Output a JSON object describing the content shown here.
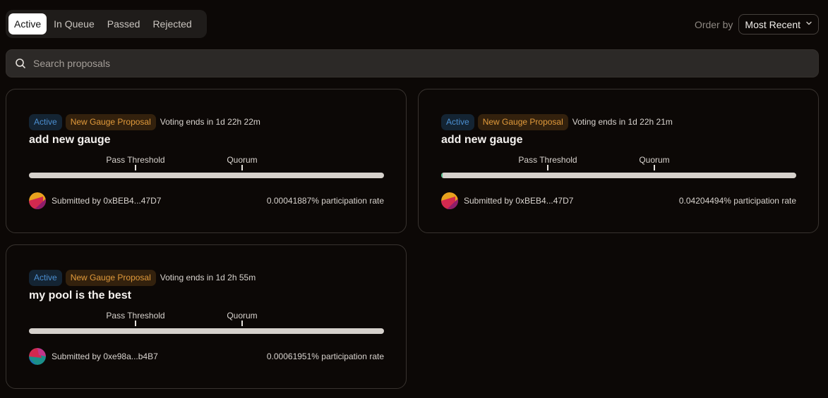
{
  "tabs": [
    {
      "label": "Active",
      "active": true
    },
    {
      "label": "In Queue",
      "active": false
    },
    {
      "label": "Passed",
      "active": false
    },
    {
      "label": "Rejected",
      "active": false
    }
  ],
  "order": {
    "label": "Order by",
    "value": "Most Recent"
  },
  "search": {
    "placeholder": "Search proposals",
    "icon": "search-icon"
  },
  "labels": {
    "pass_threshold": "Pass Threshold",
    "quorum": "Quorum"
  },
  "colors": {
    "status_active": "#4c8fd1",
    "type_badge": "#e19a3b",
    "progress_fill": "#4fbf8a"
  },
  "proposals": [
    {
      "status": "Active",
      "type": "New Gauge Proposal",
      "voting_ends": "Voting ends in 1d 22h 22m",
      "title": "add new gauge",
      "submitted_by": "Submitted by 0xBEB4...47D7",
      "participation": "0.00041887% participation rate",
      "progress_fraction": 0.0,
      "pass_threshold_fraction": 0.3,
      "quorum_fraction": 0.6
    },
    {
      "status": "Active",
      "type": "New Gauge Proposal",
      "voting_ends": "Voting ends in 1d 22h 21m",
      "title": "add new gauge",
      "submitted_by": "Submitted by 0xBEB4...47D7",
      "participation": "0.04204494% participation rate",
      "progress_fraction": 0.004,
      "pass_threshold_fraction": 0.3,
      "quorum_fraction": 0.6
    },
    {
      "status": "Active",
      "type": "New Gauge Proposal",
      "voting_ends": "Voting ends in 1d 2h 55m",
      "title": "my pool is the best",
      "submitted_by": "Submitted by 0xe98a...b4B7",
      "participation": "0.00061951% participation rate",
      "progress_fraction": 0.0,
      "pass_threshold_fraction": 0.3,
      "quorum_fraction": 0.6
    }
  ]
}
